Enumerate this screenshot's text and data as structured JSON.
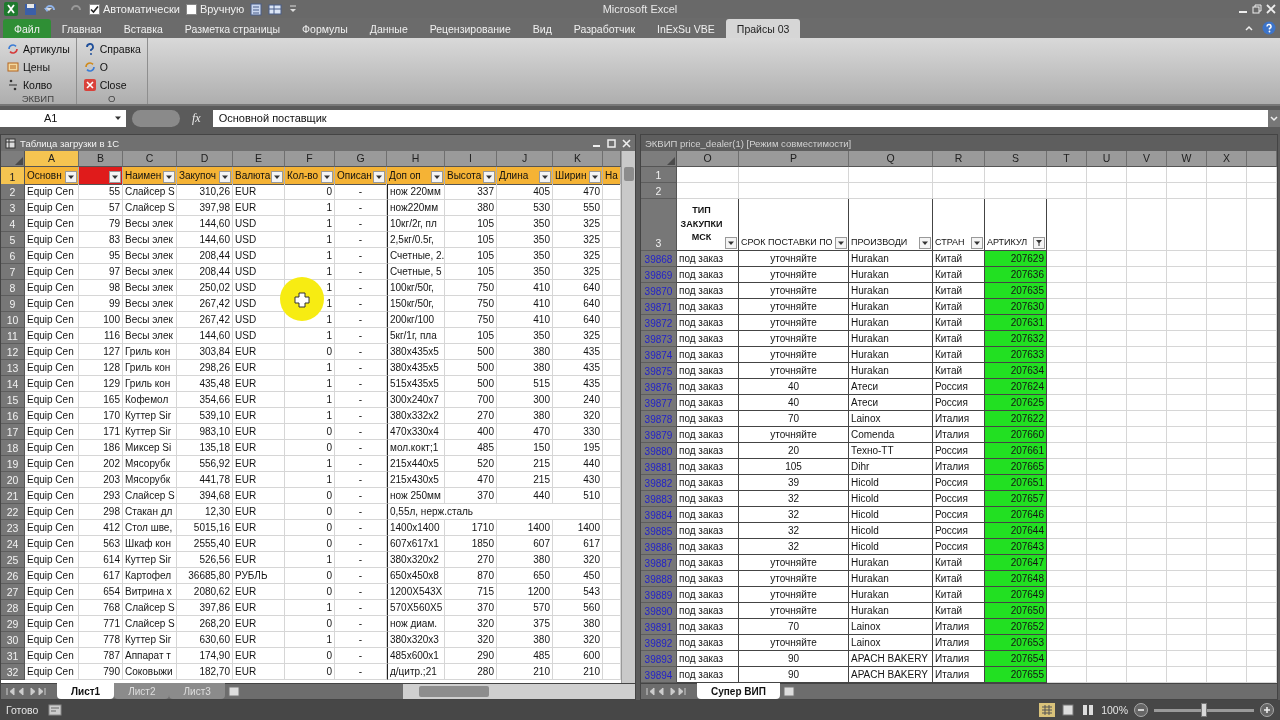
{
  "window": {
    "title": "Microsoft Excel"
  },
  "quick_access": {
    "checkboxes": [
      {
        "label": "Автоматически",
        "checked": true
      },
      {
        "label": "Вручную",
        "checked": false
      }
    ]
  },
  "ribbon_tabs": [
    {
      "label": "Файл",
      "kind": "file",
      "selected": false
    },
    {
      "label": "Главная",
      "kind": "tab",
      "selected": false
    },
    {
      "label": "Вставка",
      "kind": "tab",
      "selected": false
    },
    {
      "label": "Разметка страницы",
      "kind": "tab",
      "selected": false
    },
    {
      "label": "Формулы",
      "kind": "tab",
      "selected": false
    },
    {
      "label": "Данные",
      "kind": "tab",
      "selected": false
    },
    {
      "label": "Рецензирование",
      "kind": "tab",
      "selected": false
    },
    {
      "label": "Вид",
      "kind": "tab",
      "selected": false
    },
    {
      "label": "Разработчик",
      "kind": "tab",
      "selected": false
    },
    {
      "label": "InExSu VBE",
      "kind": "tab",
      "selected": false
    },
    {
      "label": "Прайсы 03",
      "kind": "tab",
      "selected": true
    }
  ],
  "ribbon_groups": [
    {
      "label": "ЭКВИП",
      "items": [
        {
          "label": "Артикулы",
          "kind": "articles"
        },
        {
          "label": "Цены",
          "kind": "prices"
        },
        {
          "label": "Колво",
          "kind": "quantity"
        }
      ]
    },
    {
      "label": "О",
      "items": [
        {
          "label": "Справка",
          "kind": "help"
        },
        {
          "label": "О",
          "kind": "about"
        },
        {
          "label": "Close",
          "kind": "close"
        }
      ]
    }
  ],
  "formula_bar": {
    "name_box": "A1",
    "function_label": "fx",
    "value": "Основной поставщик"
  },
  "left_window": {
    "title": "Таблица загрузки в 1С",
    "active": true,
    "columns": [
      {
        "letter": "A",
        "selected": true
      },
      {
        "letter": "B",
        "selected": false
      },
      {
        "letter": "C",
        "selected": false
      },
      {
        "letter": "D",
        "selected": false
      },
      {
        "letter": "E",
        "selected": false
      },
      {
        "letter": "F",
        "selected": false
      },
      {
        "letter": "G",
        "selected": false
      },
      {
        "letter": "H",
        "selected": false
      },
      {
        "letter": "I",
        "selected": false
      },
      {
        "letter": "J",
        "selected": false
      },
      {
        "letter": "K",
        "selected": false
      }
    ],
    "header_row": {
      "row": "1",
      "selected": true,
      "cells": [
        {
          "label": "Основн",
          "color": "#f5b335",
          "filter_button": true
        },
        {
          "color": "#e01b1b",
          "filter_button": true
        },
        {
          "label": "Наимен",
          "color": "#f5b335",
          "filter_button": true
        },
        {
          "label": "Закупоч",
          "color": "#f5b335",
          "filter_button": true
        },
        {
          "label": "Валюта",
          "color": "#f5b335",
          "filter_button": true
        },
        {
          "label": "Кол-во",
          "color": "#f5b335",
          "filter_button": true
        },
        {
          "label": "Описан",
          "color": "#f5b335",
          "filter_button": true
        },
        {
          "label": "Доп оп",
          "color": "#f5b335",
          "filter_button": true
        },
        {
          "label": "Высота",
          "color": "#f5b335",
          "filter_button": true
        },
        {
          "label": "Длина",
          "color": "#f5b335",
          "filter_button": true
        },
        {
          "label": "Ширин",
          "color": "#f5b335",
          "filter_button": true
        },
        {
          "label": "На",
          "color": "#f5b335"
        }
      ]
    },
    "rows": [
      {
        "row": "2",
        "cells": [
          "Equip Cen",
          "55",
          "Слайсер S",
          "310,26",
          "EUR",
          "0",
          "-",
          "нож 220мм",
          "337",
          "405",
          "470"
        ]
      },
      {
        "row": "3",
        "cells": [
          "Equip Cen",
          "57",
          "Слайсер S",
          "397,98",
          "EUR",
          "1",
          "-",
          "нож220мм",
          "380",
          "530",
          "550"
        ]
      },
      {
        "row": "4",
        "cells": [
          "Equip Cen",
          "79",
          "Весы элек",
          "144,60",
          "USD",
          "1",
          "-",
          "10кг/2г, пл",
          "105",
          "350",
          "325"
        ]
      },
      {
        "row": "5",
        "cells": [
          "Equip Cen",
          "83",
          "Весы элек",
          "144,60",
          "USD",
          "1",
          "-",
          "2,5кг/0.5г,",
          "105",
          "350",
          "325"
        ]
      },
      {
        "row": "6",
        "cells": [
          "Equip Cen",
          "95",
          "Весы элек",
          "208,44",
          "USD",
          "1",
          "-",
          "Счетные, 2.",
          "105",
          "350",
          "325"
        ]
      },
      {
        "row": "7",
        "cells": [
          "Equip Cen",
          "97",
          "Весы элек",
          "208,44",
          "USD",
          "1",
          "-",
          "Счетные, 5",
          "105",
          "350",
          "325"
        ]
      },
      {
        "row": "8",
        "cells": [
          "Equip Cen",
          "98",
          "Весы элек",
          "250,02",
          "USD",
          "1",
          "-",
          "100кг/50г,",
          "750",
          "410",
          "640"
        ]
      },
      {
        "row": "9",
        "cells": [
          "Equip Cen",
          "99",
          "Весы элек",
          "267,42",
          "USD",
          "1",
          "-",
          "150кг/50г,",
          "750",
          "410",
          "640"
        ]
      },
      {
        "row": "10",
        "cells": [
          "Equip Cen",
          "100",
          "Весы элек",
          "267,42",
          "USD",
          "1",
          "-",
          "200кг/100",
          "750",
          "410",
          "640"
        ]
      },
      {
        "row": "11",
        "cells": [
          "Equip Cen",
          "116",
          "Весы элек",
          "144,60",
          "USD",
          "1",
          "-",
          "5кг/1г, пла",
          "105",
          "350",
          "325"
        ]
      },
      {
        "row": "12",
        "cells": [
          "Equip Cen",
          "127",
          "Гриль кон",
          "303,84",
          "EUR",
          "0",
          "-",
          "380x435x5",
          "500",
          "380",
          "435"
        ]
      },
      {
        "row": "13",
        "cells": [
          "Equip Cen",
          "128",
          "Гриль кон",
          "298,26",
          "EUR",
          "1",
          "-",
          "380x435x5",
          "500",
          "380",
          "435"
        ]
      },
      {
        "row": "14",
        "cells": [
          "Equip Cen",
          "129",
          "Гриль кон",
          "435,48",
          "EUR",
          "1",
          "-",
          "515x435x5",
          "500",
          "515",
          "435"
        ]
      },
      {
        "row": "15",
        "cells": [
          "Equip Cen",
          "165",
          "Кофемол",
          "354,66",
          "EUR",
          "1",
          "-",
          "300x240x7",
          "700",
          "300",
          "240"
        ]
      },
      {
        "row": "16",
        "cells": [
          "Equip Cen",
          "170",
          "Куттер Sir",
          "539,10",
          "EUR",
          "1",
          "-",
          "380x332x2",
          "270",
          "380",
          "320"
        ]
      },
      {
        "row": "17",
        "cells": [
          "Equip Cen",
          "171",
          "Куттер Sir",
          "983,10",
          "EUR",
          "0",
          "-",
          "470x330x4",
          "400",
          "470",
          "330"
        ]
      },
      {
        "row": "18",
        "cells": [
          "Equip Cen",
          "186",
          "Миксер Si",
          "135,18",
          "EUR",
          "0",
          "-",
          "мол.кокт;1",
          "485",
          "150",
          "195"
        ]
      },
      {
        "row": "19",
        "cells": [
          "Equip Cen",
          "202",
          "Мясорубк",
          "556,92",
          "EUR",
          "1",
          "-",
          "215x440x5",
          "520",
          "215",
          "440"
        ]
      },
      {
        "row": "20",
        "cells": [
          "Equip Cen",
          "203",
          "Мясорубк",
          "441,78",
          "EUR",
          "1",
          "-",
          "215x430x5",
          "470",
          "215",
          "430"
        ]
      },
      {
        "row": "21",
        "cells": [
          "Equip Cen",
          "293",
          "Слайсер S",
          "394,68",
          "EUR",
          "0",
          "-",
          "нож 250мм",
          "370",
          "440",
          "510"
        ]
      },
      {
        "row": "22",
        "cells": [
          "Equip Cen",
          "298",
          "Стакан дл",
          "12,30",
          "EUR",
          "0",
          "-",
          "0,55л, нерж.сталь"
        ]
      },
      {
        "row": "23",
        "cells": [
          "Equip Cen",
          "412",
          "Стол шве,",
          "5015,16",
          "EUR",
          "0",
          "-",
          "1400x1400",
          "1710",
          "1400",
          "1400"
        ]
      },
      {
        "row": "24",
        "cells": [
          "Equip Cen",
          "563",
          "Шкаф кон",
          "2555,40",
          "EUR",
          "0",
          "-",
          "607x617x1",
          "1850",
          "607",
          "617"
        ]
      },
      {
        "row": "25",
        "cells": [
          "Equip Cen",
          "614",
          "Куттер Sir",
          "526,56",
          "EUR",
          "1",
          "-",
          "380x320x2",
          "270",
          "380",
          "320"
        ]
      },
      {
        "row": "26",
        "cells": [
          "Equip Cen",
          "617",
          "Картофел",
          "36685,80",
          "РУБЛЬ",
          "0",
          "-",
          "650x450x8",
          "870",
          "650",
          "450"
        ]
      },
      {
        "row": "27",
        "cells": [
          "Equip Cen",
          "654",
          "Витрина х",
          "2080,62",
          "EUR",
          "0",
          "-",
          "1200X543X",
          "715",
          "1200",
          "543"
        ]
      },
      {
        "row": "28",
        "cells": [
          "Equip Cen",
          "768",
          "Слайсер S",
          "397,86",
          "EUR",
          "1",
          "-",
          "570X560X5",
          "370",
          "570",
          "560"
        ]
      },
      {
        "row": "29",
        "cells": [
          "Equip Cen",
          "771",
          "Слайсер S",
          "268,20",
          "EUR",
          "0",
          "-",
          "нож диам.",
          "320",
          "375",
          "380"
        ]
      },
      {
        "row": "30",
        "cells": [
          "Equip Cen",
          "778",
          "Куттер Sir",
          "630,60",
          "EUR",
          "1",
          "-",
          "380x320x3",
          "320",
          "380",
          "320"
        ]
      },
      {
        "row": "31",
        "cells": [
          "Equip Cen",
          "787",
          "Аппарат т",
          "174,90",
          "EUR",
          "0",
          "-",
          "485x600x1",
          "290",
          "485",
          "600"
        ]
      },
      {
        "row": "32",
        "cells": [
          "Equip Cen",
          "790",
          "Соковыжи",
          "182,70",
          "EUR",
          "0",
          "-",
          "д/цитр.;21",
          "280",
          "210",
          "210"
        ]
      }
    ],
    "sheets": [
      {
        "label": "Лист1",
        "selected": true
      },
      {
        "label": "Лист2",
        "selected": false
      },
      {
        "label": "Лист3",
        "selected": false
      }
    ]
  },
  "right_window": {
    "title": "ЭКВИП price_dealer(1)  [Режим совместимости]",
    "active": false,
    "columns": [
      {
        "letter": "O"
      },
      {
        "letter": "P"
      },
      {
        "letter": "Q"
      },
      {
        "letter": "R"
      },
      {
        "letter": "S"
      },
      {
        "letter": "T"
      },
      {
        "letter": "U"
      },
      {
        "letter": "V"
      },
      {
        "letter": "W"
      },
      {
        "letter": "X"
      }
    ],
    "blank_rows": [
      "1",
      "2"
    ],
    "header_row": {
      "row": "3",
      "cells": [
        {
          "label": "ТИП ЗАКУПКИ МСК",
          "filter_button": true,
          "filtered": false
        },
        {
          "label": "СРОК ПОСТАВКИ ПО",
          "filter_button": true,
          "filtered": false
        },
        {
          "label": "ПРОИЗВОДИ",
          "filter_button": true,
          "filtered": false
        },
        {
          "label": "СТРАН",
          "filter_button": true,
          "filtered": false
        },
        {
          "label": "АРТИКУЛ",
          "filter_button": true,
          "filtered": true
        }
      ]
    },
    "rows": [
      {
        "row": "39868",
        "cells": [
          "под заказ",
          "уточняйте",
          "Hurakan",
          "Китай",
          "207629"
        ]
      },
      {
        "row": "39869",
        "cells": [
          "под заказ",
          "уточняйте",
          "Hurakan",
          "Китай",
          "207636"
        ]
      },
      {
        "row": "39870",
        "cells": [
          "под заказ",
          "уточняйте",
          "Hurakan",
          "Китай",
          "207635"
        ]
      },
      {
        "row": "39871",
        "cells": [
          "под заказ",
          "уточняйте",
          "Hurakan",
          "Китай",
          "207630"
        ]
      },
      {
        "row": "39872",
        "cells": [
          "под заказ",
          "уточняйте",
          "Hurakan",
          "Китай",
          "207631"
        ]
      },
      {
        "row": "39873",
        "cells": [
          "под заказ",
          "уточняйте",
          "Hurakan",
          "Китай",
          "207632"
        ]
      },
      {
        "row": "39874",
        "cells": [
          "под заказ",
          "уточняйте",
          "Hurakan",
          "Китай",
          "207633"
        ]
      },
      {
        "row": "39875",
        "cells": [
          "под заказ",
          "уточняйте",
          "Hurakan",
          "Китай",
          "207634"
        ]
      },
      {
        "row": "39876",
        "cells": [
          "под заказ",
          "40",
          "Атеси",
          "Россия",
          "207624"
        ]
      },
      {
        "row": "39877",
        "cells": [
          "под заказ",
          "40",
          "Атеси",
          "Россия",
          "207625"
        ]
      },
      {
        "row": "39878",
        "cells": [
          "под заказ",
          "70",
          "Lainox",
          "Италия",
          "207622"
        ]
      },
      {
        "row": "39879",
        "cells": [
          "под заказ",
          "уточняйте",
          "Comenda",
          "Италия",
          "207660"
        ]
      },
      {
        "row": "39880",
        "cells": [
          "под заказ",
          "20",
          "Техно-ТТ",
          "Россия",
          "207661"
        ]
      },
      {
        "row": "39881",
        "cells": [
          "под заказ",
          "105",
          "Dihr",
          "Италия",
          "207665"
        ]
      },
      {
        "row": "39882",
        "cells": [
          "под заказ",
          "39",
          "Hicold",
          "Россия",
          "207651"
        ]
      },
      {
        "row": "39883",
        "cells": [
          "под заказ",
          "32",
          "Hicold",
          "Россия",
          "207657"
        ]
      },
      {
        "row": "39884",
        "cells": [
          "под заказ",
          "32",
          "Hicold",
          "Россия",
          "207646"
        ]
      },
      {
        "row": "39885",
        "cells": [
          "под заказ",
          "32",
          "Hicold",
          "Россия",
          "207644"
        ]
      },
      {
        "row": "39886",
        "cells": [
          "под заказ",
          "32",
          "Hicold",
          "Россия",
          "207643"
        ]
      },
      {
        "row": "39887",
        "cells": [
          "под заказ",
          "уточняйте",
          "Hurakan",
          "Китай",
          "207647"
        ]
      },
      {
        "row": "39888",
        "cells": [
          "под заказ",
          "уточняйте",
          "Hurakan",
          "Китай",
          "207648"
        ]
      },
      {
        "row": "39889",
        "cells": [
          "под заказ",
          "уточняйте",
          "Hurakan",
          "Китай",
          "207649"
        ]
      },
      {
        "row": "39890",
        "cells": [
          "под заказ",
          "уточняйте",
          "Hurakan",
          "Китай",
          "207650"
        ]
      },
      {
        "row": "39891",
        "cells": [
          "под заказ",
          "70",
          "Lainox",
          "Италия",
          "207652"
        ]
      },
      {
        "row": "39892",
        "cells": [
          "под заказ",
          "уточняйте",
          "Lainox",
          "Италия",
          "207653"
        ]
      },
      {
        "row": "39893",
        "cells": [
          "под заказ",
          "90",
          "APACH BAKERY",
          "Италия",
          "207654"
        ]
      },
      {
        "row": "39894",
        "cells": [
          "под заказ",
          "90",
          "APACH BAKERY",
          "Италия",
          "207655"
        ]
      }
    ],
    "sheets": [
      {
        "label": "Супер ВИП",
        "selected": true
      }
    ]
  },
  "status_bar": {
    "text": "Готово",
    "zoom": "100%",
    "zoom_slider": {
      "level": 0.5
    }
  }
}
